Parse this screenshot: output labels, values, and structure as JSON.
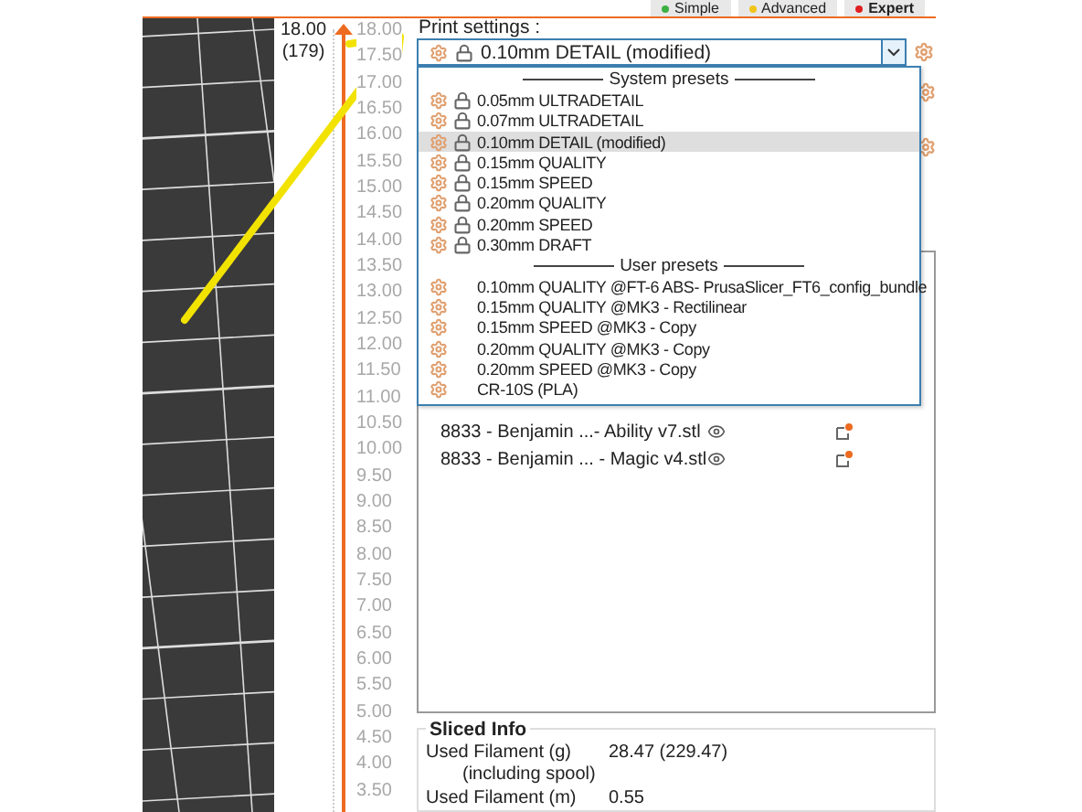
{
  "mode_buttons": [
    {
      "label": "Simple",
      "color": "#3cb043"
    },
    {
      "label": "Advanced",
      "color": "#f0c419"
    },
    {
      "label": "Expert",
      "color": "#e02020"
    }
  ],
  "layer_slider": {
    "top_value": "18.00",
    "top_layer": "(179)",
    "ticks": [
      "18.00",
      "17.50",
      "17.00",
      "16.50",
      "16.00",
      "15.50",
      "15.00",
      "14.50",
      "14.00",
      "13.50",
      "13.00",
      "12.50",
      "12.00",
      "11.50",
      "11.00",
      "10.50",
      "10.00",
      "9.50",
      "9.00",
      "8.50",
      "8.00",
      "7.50",
      "7.00",
      "6.50",
      "6.00",
      "5.50",
      "5.00",
      "4.50",
      "4.00",
      "3.50"
    ]
  },
  "print_settings": {
    "label": "Print settings :",
    "value": "0.10mm DETAIL (modified)",
    "dropdown": [
      {
        "kind": "header",
        "label": "System presets"
      },
      {
        "kind": "system",
        "label": "0.05mm ULTRADETAIL",
        "selected": false
      },
      {
        "kind": "system",
        "label": "0.07mm ULTRADETAIL",
        "selected": false
      },
      {
        "kind": "system",
        "label": "0.10mm DETAIL (modified)",
        "selected": true
      },
      {
        "kind": "system",
        "label": "0.15mm QUALITY",
        "selected": false
      },
      {
        "kind": "system",
        "label": "0.15mm SPEED",
        "selected": false
      },
      {
        "kind": "system",
        "label": "0.20mm QUALITY",
        "selected": false
      },
      {
        "kind": "system",
        "label": "0.20mm SPEED",
        "selected": false
      },
      {
        "kind": "system",
        "label": "0.30mm DRAFT",
        "selected": false
      },
      {
        "kind": "header",
        "label": "User presets"
      },
      {
        "kind": "user",
        "label": "0.10mm QUALITY @FT-6 ABS- PrusaSlicer_FT6_config_bundle",
        "selected": false
      },
      {
        "kind": "user",
        "label": "0.15mm QUALITY @MK3 - Rectilinear",
        "selected": false
      },
      {
        "kind": "user",
        "label": "0.15mm SPEED @MK3 - Copy",
        "selected": false
      },
      {
        "kind": "user",
        "label": "0.20mm QUALITY @MK3 - Copy",
        "selected": false
      },
      {
        "kind": "user",
        "label": "0.20mm SPEED @MK3 - Copy",
        "selected": false
      },
      {
        "kind": "user",
        "label": "CR-10S (PLA)",
        "selected": false
      }
    ]
  },
  "objects": [
    {
      "name": "8833 - Benjamin ...- Ability v7.stl",
      "visible": true
    },
    {
      "name": "8833 - Benjamin ... - Magic v4.stl",
      "visible": true
    }
  ],
  "sliced_info": {
    "title": "Sliced Info",
    "rows": [
      {
        "label": "Used Filament (g)",
        "sublabel": "(including spool)",
        "value": "28.47 (229.47)"
      },
      {
        "label": "Used Filament (m)",
        "value": "0.55"
      }
    ]
  }
}
